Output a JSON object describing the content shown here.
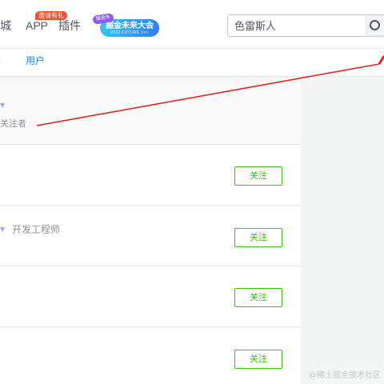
{
  "header": {
    "nav": {
      "mall_partial": "城",
      "app": "APP",
      "app_badge": "邀请有礼",
      "plugin": "插件"
    },
    "banner": {
      "tag": "掘金年",
      "title": "掘金未来大会",
      "subtitle": "2022 FUTURE >>>"
    },
    "search": {
      "placeholder": "色雷斯人",
      "button_icon": "search-icon"
    }
  },
  "tabs": {
    "partial": "‹",
    "active": "用户"
  },
  "list": {
    "rows": [
      {
        "info_label": "关注者",
        "level_icon": "level-badge-icon"
      },
      {
        "button_label": "关注"
      },
      {
        "job": "开发工程师",
        "button_label": "关注",
        "level_icon": "level-badge-icon"
      },
      {
        "button_label": "关注"
      },
      {
        "button_label": "关注"
      }
    ]
  },
  "colors": {
    "accent": "#1e80ff",
    "follow_green": "#37c700",
    "annotation_red": "#e0261e",
    "hot_badge": "#ee502f"
  },
  "watermark": "@稀土掘金技术社区"
}
